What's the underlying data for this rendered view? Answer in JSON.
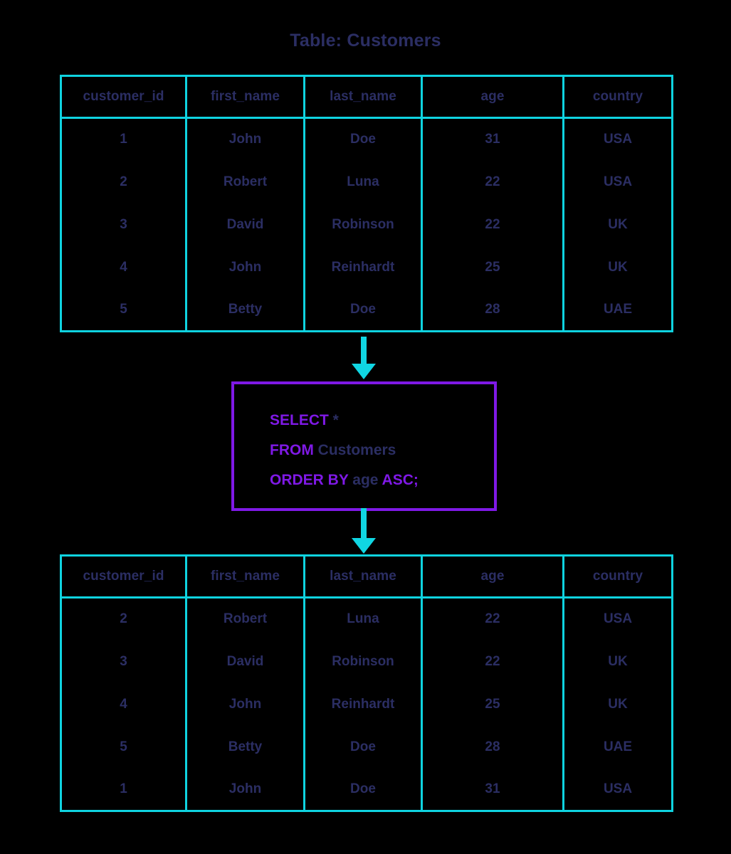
{
  "title": "Table: Customers",
  "colors": {
    "background": "#000000",
    "table_border": "#0fd3e0",
    "arrow": "#10d6e3",
    "text_navy": "#2b2e63",
    "sql_keyword": "#7f19e6",
    "sql_box_border": "#7f19e6"
  },
  "source_table": {
    "name": "Customers",
    "columns": [
      "customer_id",
      "first_name",
      "last_name",
      "age",
      "country"
    ],
    "rows": [
      [
        "1",
        "John",
        "Doe",
        "31",
        "USA"
      ],
      [
        "2",
        "Robert",
        "Luna",
        "22",
        "USA"
      ],
      [
        "3",
        "David",
        "Robinson",
        "22",
        "UK"
      ],
      [
        "4",
        "John",
        "Reinhardt",
        "25",
        "UK"
      ],
      [
        "5",
        "Betty",
        "Doe",
        "28",
        "UAE"
      ]
    ]
  },
  "query": {
    "lines": [
      {
        "parts": [
          {
            "text": "SELECT",
            "kind": "keyword"
          },
          {
            "text": " *",
            "kind": "plain"
          }
        ]
      },
      {
        "parts": [
          {
            "text": "FROM",
            "kind": "keyword"
          },
          {
            "text": " Customers",
            "kind": "plain"
          }
        ]
      },
      {
        "parts": [
          {
            "text": "ORDER BY",
            "kind": "keyword"
          },
          {
            "text": " age ",
            "kind": "plain"
          },
          {
            "text": "ASC",
            "kind": "keyword"
          },
          {
            "text": ";",
            "kind": "punct"
          }
        ]
      }
    ],
    "text": "SELECT * FROM Customers ORDER BY age ASC;"
  },
  "result_table": {
    "columns": [
      "customer_id",
      "first_name",
      "last_name",
      "age",
      "country"
    ],
    "rows": [
      [
        "2",
        "Robert",
        "Luna",
        "22",
        "USA"
      ],
      [
        "3",
        "David",
        "Robinson",
        "22",
        "UK"
      ],
      [
        "4",
        "John",
        "Reinhardt",
        "25",
        "UK"
      ],
      [
        "5",
        "Betty",
        "Doe",
        "28",
        "UAE"
      ],
      [
        "1",
        "John",
        "Doe",
        "31",
        "USA"
      ]
    ]
  },
  "arrows": {
    "top": "arrow-down-icon",
    "bottom": "arrow-down-icon"
  }
}
